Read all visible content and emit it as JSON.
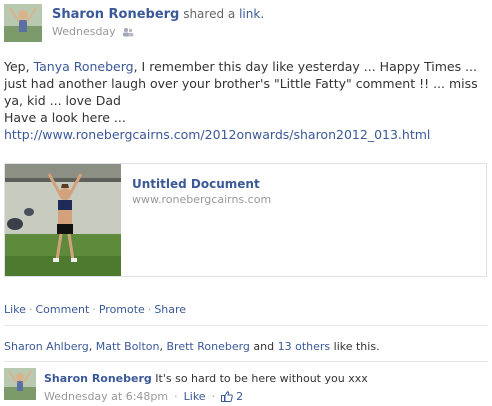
{
  "post": {
    "author": "Sharon Roneberg",
    "shared_text": "shared a",
    "shared_link": "link.",
    "timestamp": "Wednesday",
    "audience_icon": "friends-icon",
    "message_prefix": "Yep, ",
    "tagged_name": "Tanya Roneberg",
    "message_body": ", I remember this day like yesterday ... Happy Times ... just had another laugh over your brother's \"Little Fatty\" comment !! ... miss ya, kid ... love Dad",
    "message_line2": "Have a look here ...",
    "message_url": "http://www.ronebergcairns.com/2012onwards/sharon2012_013.html"
  },
  "attachment": {
    "title": "Untitled Document",
    "domain": "www.ronebergcairns.com"
  },
  "actions": {
    "like": "Like",
    "comment": "Comment",
    "promote": "Promote",
    "share": "Share",
    "separator": "·"
  },
  "likes": {
    "name1": "Sharon Ahlberg",
    "name2": "Matt Bolton",
    "name3": "Brett Roneberg",
    "and_text": "and",
    "others": "13 others",
    "suffix": "like this."
  },
  "comment": {
    "author": "Sharon Roneberg",
    "text": "It's so hard to be here without you xxx",
    "timestamp": "Wednesday at 6:48pm",
    "like": "Like",
    "like_count": "2",
    "separator": "·"
  },
  "colors": {
    "link": "#3b5998",
    "muted": "#999999",
    "text": "#333333",
    "border": "#dfe2e8"
  }
}
